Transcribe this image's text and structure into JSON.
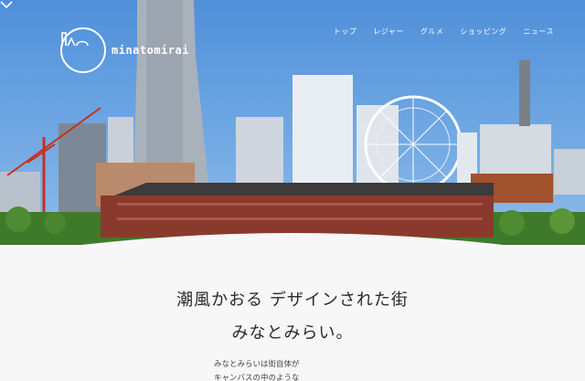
{
  "brand": {
    "name": "minatomirai"
  },
  "nav": {
    "items": [
      "トップ",
      "レジャー",
      "グルメ",
      "ショッピング",
      "ニュース"
    ]
  },
  "hero": {
    "scroll_icon": "chevron-down-icon"
  },
  "intro": {
    "headline_line1": "潮風かおる デザインされた街",
    "headline_line2": "みなとみらい。",
    "body_line1": "みなとみらいは街自体が",
    "body_line2": "キャンバスの中のような"
  },
  "colors": {
    "sky": "#5b97dc",
    "brick": "#8a3a2c",
    "tree": "#3f7a2a",
    "background": "#f7f7f7"
  }
}
